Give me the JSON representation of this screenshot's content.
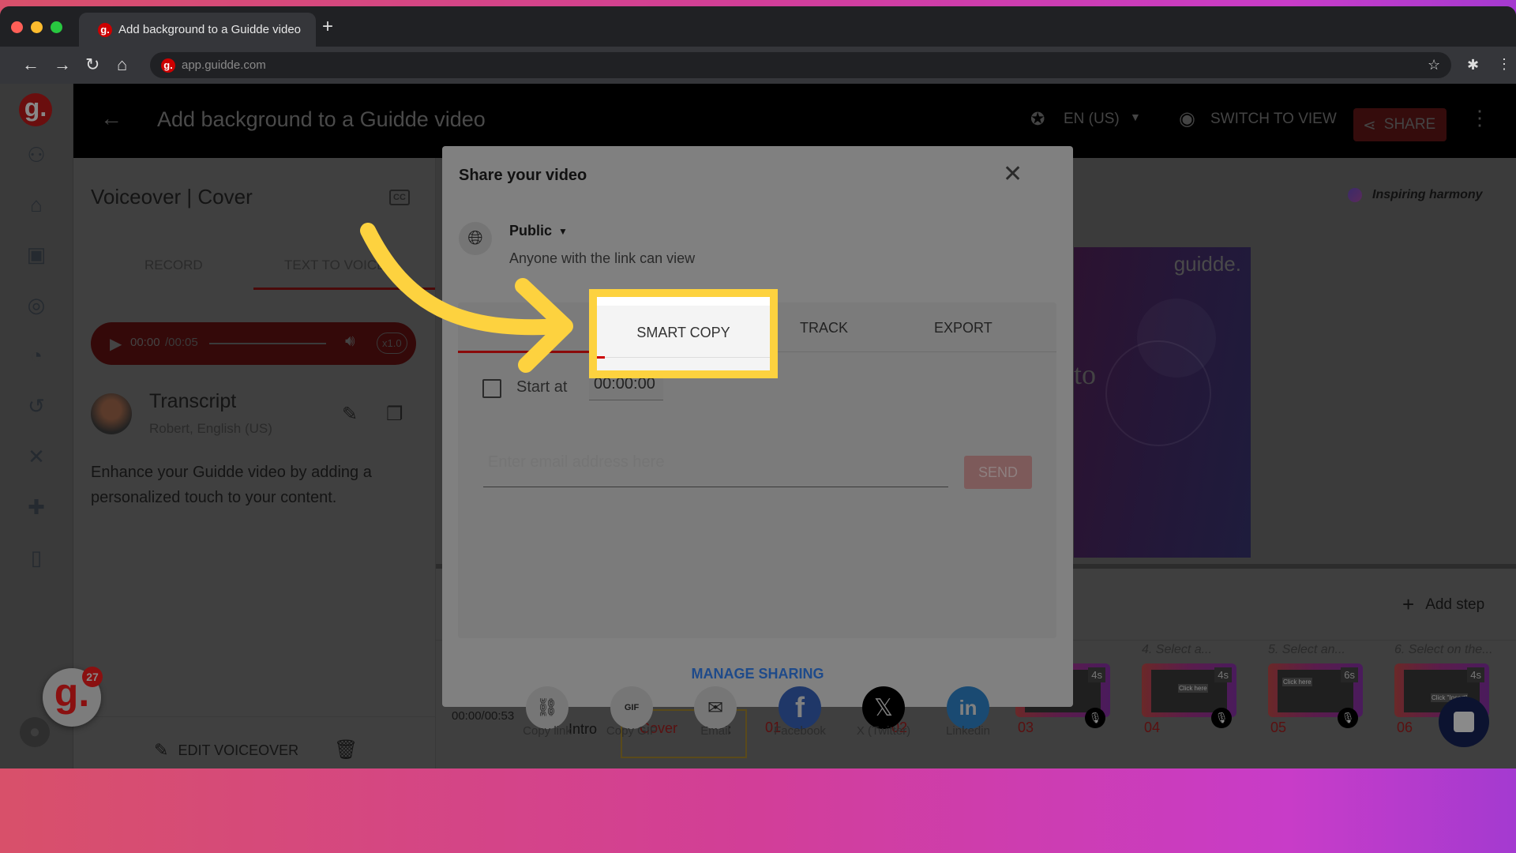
{
  "browser": {
    "tab_title": "Add background to a Guidde video",
    "url": "app.guidde.com",
    "favicon": "g."
  },
  "header": {
    "title": "Add background to a Guidde video",
    "language": "EN (US)",
    "switch_view": "SWITCH TO VIEW",
    "share": "SHARE"
  },
  "left_panel": {
    "title": "Voiceover | Cover",
    "tabs": [
      "RECORD",
      "TEXT TO VOICE"
    ],
    "player_time": "00:00",
    "player_total": "/00:05",
    "speed": "x1.0",
    "transcript_title": "Transcript",
    "voice": "Robert, English (US)",
    "transcript": "Enhance your Guidde video by adding a personalized touch to your content.",
    "edit_voiceover": "EDIT VOICEOVER"
  },
  "sidebar": {
    "badge_count": "27",
    "logo": "g."
  },
  "preview": {
    "music": "Inspiring harmony",
    "brand": "guidde.",
    "partial_text": "to"
  },
  "timeline": {
    "time": "00:00/00:53",
    "intro": "Intro",
    "cover": "Cover",
    "add_step": "Add step",
    "step_numbers": [
      "01",
      "02",
      "03",
      "04",
      "05",
      "06"
    ],
    "step_titles": [
      "4. Select a...",
      "5. Select an...",
      "6. Select on the..."
    ],
    "durations": [
      "4s",
      "4s",
      "6s",
      "4s"
    ],
    "thumb_captions": [
      "Click here",
      "Click here",
      "Click \"Insert\""
    ]
  },
  "modal": {
    "title": "Share your video",
    "visibility": "Public",
    "visibility_desc": "Anyone with the link can view",
    "tabs": [
      "SMART COPY",
      "TRACK",
      "EXPORT"
    ],
    "active_tab": "SMART COPY",
    "start_at_label": "Start at",
    "start_at_value": "00:00:00",
    "email_placeholder": "Enter email address here",
    "send": "SEND",
    "share_options": [
      {
        "label": "Copy link",
        "icon": "link-icon"
      },
      {
        "label": "Copy GIF",
        "icon": "gif-icon",
        "glyph": "GIF"
      },
      {
        "label": "Email",
        "icon": "email-icon"
      },
      {
        "label": "Facebook",
        "icon": "facebook-icon",
        "color": "#1f3768"
      },
      {
        "label": "X (Twitter)",
        "icon": "x-icon",
        "color": "#000000"
      },
      {
        "label": "Linkedin",
        "icon": "linkedin-icon",
        "color": "#1a4a72"
      }
    ],
    "manage_sharing": "MANAGE SHARING"
  },
  "colors": {
    "highlight": "#fdd23f",
    "accent": "#c00000",
    "link": "#1e4a8a"
  }
}
